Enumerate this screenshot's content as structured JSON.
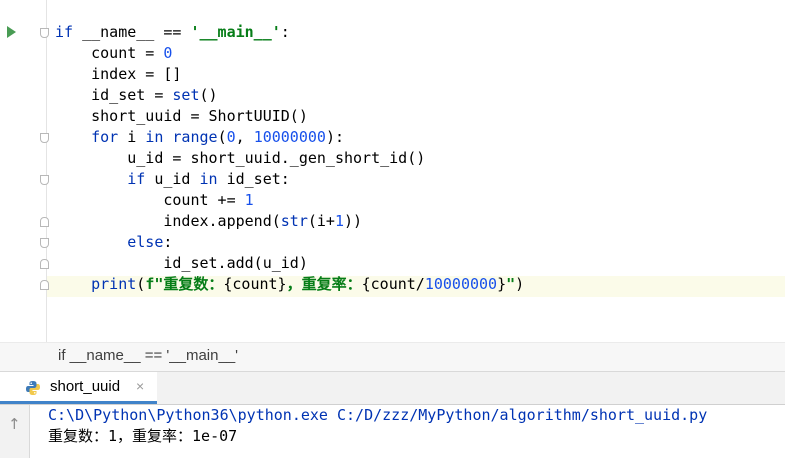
{
  "editor": {
    "lines": [
      {
        "parts": [
          {
            "t": "if ",
            "c": "kw"
          },
          {
            "t": "__name__",
            "c": ""
          },
          {
            "t": " == ",
            "c": ""
          },
          {
            "t": "'__main__'",
            "c": "str"
          },
          {
            "t": ":",
            "c": ""
          }
        ]
      },
      {
        "parts": [
          {
            "t": "    count = ",
            "c": ""
          },
          {
            "t": "0",
            "c": "num"
          }
        ]
      },
      {
        "parts": [
          {
            "t": "    index = []",
            "c": ""
          }
        ]
      },
      {
        "parts": [
          {
            "t": "    id_set = ",
            "c": ""
          },
          {
            "t": "set",
            "c": "kw"
          },
          {
            "t": "()",
            "c": ""
          }
        ]
      },
      {
        "parts": [
          {
            "t": "    short_uuid = ShortUUID()",
            "c": ""
          }
        ]
      },
      {
        "parts": [
          {
            "t": "    ",
            "c": ""
          },
          {
            "t": "for",
            "c": "kw"
          },
          {
            "t": " i ",
            "c": ""
          },
          {
            "t": "in",
            "c": "kw"
          },
          {
            "t": " ",
            "c": ""
          },
          {
            "t": "range",
            "c": "kw"
          },
          {
            "t": "(",
            "c": ""
          },
          {
            "t": "0",
            "c": "num"
          },
          {
            "t": ", ",
            "c": ""
          },
          {
            "t": "10000000",
            "c": "num"
          },
          {
            "t": "):",
            "c": ""
          }
        ]
      },
      {
        "parts": [
          {
            "t": "        u_id = short_uuid._gen_short_id()",
            "c": ""
          }
        ]
      },
      {
        "parts": [
          {
            "t": "        ",
            "c": ""
          },
          {
            "t": "if",
            "c": "kw"
          },
          {
            "t": " u_id ",
            "c": ""
          },
          {
            "t": "in",
            "c": "kw"
          },
          {
            "t": " id_set:",
            "c": ""
          }
        ]
      },
      {
        "parts": [
          {
            "t": "            count += ",
            "c": ""
          },
          {
            "t": "1",
            "c": "num"
          }
        ]
      },
      {
        "parts": [
          {
            "t": "            index.append(",
            "c": ""
          },
          {
            "t": "str",
            "c": "kw"
          },
          {
            "t": "(i+",
            "c": ""
          },
          {
            "t": "1",
            "c": "num"
          },
          {
            "t": "))",
            "c": ""
          }
        ]
      },
      {
        "parts": [
          {
            "t": "        ",
            "c": ""
          },
          {
            "t": "else",
            "c": "kw"
          },
          {
            "t": ":",
            "c": ""
          }
        ]
      },
      {
        "parts": [
          {
            "t": "            id_set.add(u_id)",
            "c": ""
          }
        ]
      },
      {
        "parts": [
          {
            "t": "    ",
            "c": ""
          },
          {
            "t": "print",
            "c": "kw"
          },
          {
            "t": "(",
            "c": ""
          },
          {
            "t": "f\"重复数：",
            "c": "str"
          },
          {
            "t": "{count}",
            "c": ""
          },
          {
            "t": "，重复率：",
            "c": "str"
          },
          {
            "t": "{count/",
            "c": ""
          },
          {
            "t": "10000000",
            "c": "num"
          },
          {
            "t": "}",
            "c": ""
          },
          {
            "t": "\"",
            "c": "str"
          },
          {
            "t": ")",
            "c": ""
          }
        ]
      }
    ]
  },
  "breadcrumb": {
    "text": "if __name__ == '__main__'"
  },
  "run_panel": {
    "tab_label": "short_uuid",
    "close_glyph": "×",
    "up_glyph": "↑"
  },
  "console": {
    "command": "C:\\D\\Python\\Python36\\python.exe C:/D/zzz/MyPython/algorithm/short_uuid.py",
    "output": "重复数：1，重复率：1e-07"
  },
  "colors": {
    "keyword": "#0033b3",
    "string": "#067d17",
    "number": "#1750eb",
    "command": "#0033b3",
    "run_icon": "#499c54",
    "tab_underline": "#4083c9"
  },
  "icons": {
    "run": "run-triangle-icon",
    "python": "python-logo-icon",
    "close": "close-icon",
    "scroll_up": "up-arrow-icon"
  }
}
